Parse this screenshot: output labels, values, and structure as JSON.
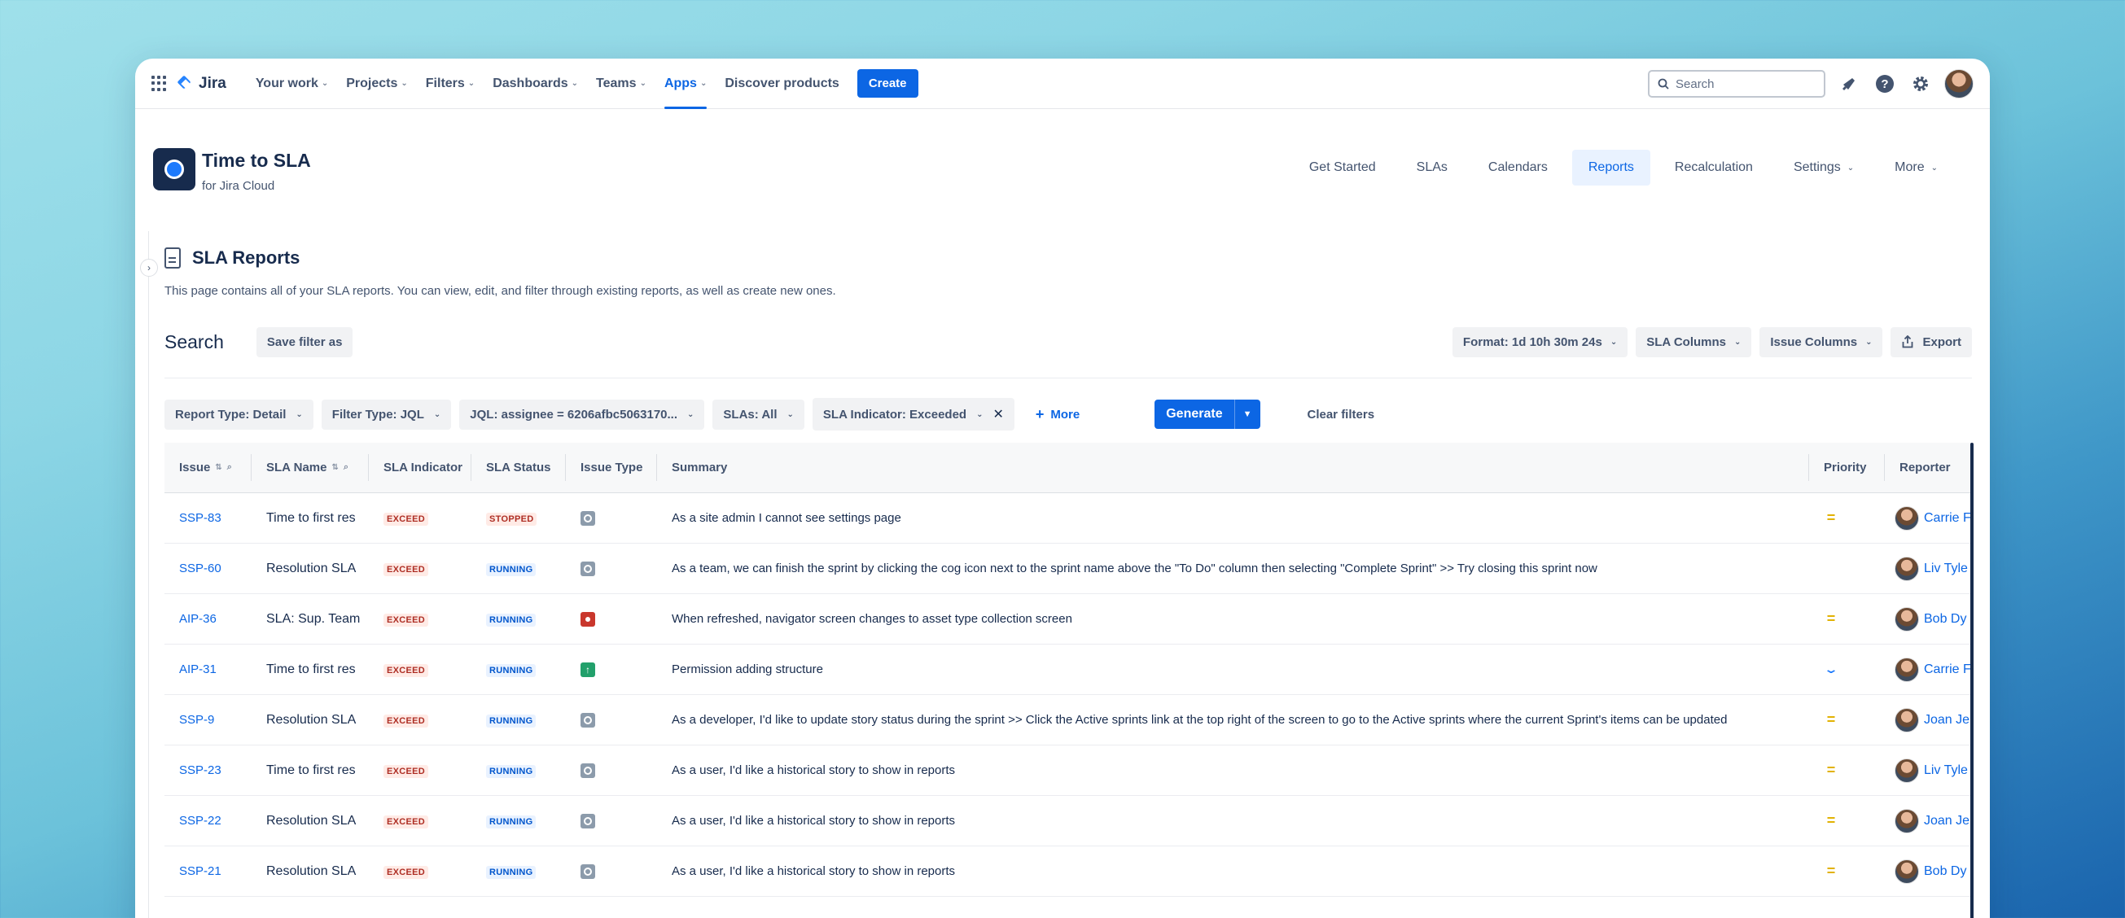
{
  "nav": {
    "logo": "Jira",
    "items": [
      {
        "label": "Your work",
        "chevron": true
      },
      {
        "label": "Projects",
        "chevron": true
      },
      {
        "label": "Filters",
        "chevron": true
      },
      {
        "label": "Dashboards",
        "chevron": true
      },
      {
        "label": "Teams",
        "chevron": true
      },
      {
        "label": "Apps",
        "chevron": true,
        "active": true
      },
      {
        "label": "Discover products",
        "chevron": false
      }
    ],
    "create_label": "Create",
    "search_placeholder": "Search"
  },
  "app": {
    "title": "Time to SLA",
    "subtitle": "for Jira Cloud",
    "tabs": [
      {
        "label": "Get Started"
      },
      {
        "label": "SLAs"
      },
      {
        "label": "Calendars"
      },
      {
        "label": "Reports",
        "active": true
      },
      {
        "label": "Recalculation"
      },
      {
        "label": "Settings",
        "chevron": true
      },
      {
        "label": "More",
        "chevron": true
      }
    ]
  },
  "page": {
    "title": "SLA Reports",
    "description": "This page contains all of your SLA reports. You can view, edit, and filter through existing reports, as well as create new ones."
  },
  "search": {
    "title": "Search",
    "save_filter": "Save filter as",
    "format": "Format: 1d 10h 30m 24s",
    "sla_columns": "SLA Columns",
    "issue_columns": "Issue Columns",
    "export": "Export"
  },
  "filters": {
    "report_type": "Report Type: Detail",
    "filter_type": "Filter Type: JQL",
    "jql": "JQL: assignee = 6206afbc5063170...",
    "slas": "SLAs: All",
    "sla_indicator": "SLA Indicator: Exceeded",
    "more": "More",
    "generate": "Generate",
    "clear": "Clear filters"
  },
  "table": {
    "headers": {
      "issue": "Issue",
      "sla_name": "SLA Name",
      "sla_indicator": "SLA Indicator",
      "sla_status": "SLA Status",
      "issue_type": "Issue Type",
      "summary": "Summary",
      "priority": "Priority",
      "reporter": "Reporter"
    },
    "rows": [
      {
        "issue": "SSP-83",
        "sla": "Time to first res",
        "indicator": "EXCEED",
        "status": "STOPPED",
        "type": "task",
        "summary": "As a site admin I cannot see settings page",
        "priority": "medium",
        "reporter": "Carrie F"
      },
      {
        "issue": "SSP-60",
        "sla": "Resolution SLA",
        "indicator": "EXCEED",
        "status": "RUNNING",
        "type": "task",
        "summary": "As a team, we can finish the sprint by clicking the cog icon next to the sprint name above the \"To Do\" column then selecting \"Complete Sprint\" >> Try closing this sprint now",
        "priority": "none",
        "reporter": "Liv Tyle"
      },
      {
        "issue": "AIP-36",
        "sla": "SLA: Sup. Team",
        "indicator": "EXCEED",
        "status": "RUNNING",
        "type": "bug",
        "summary": "When refreshed, navigator screen changes to asset type collection screen",
        "priority": "medium",
        "reporter": "Bob Dy"
      },
      {
        "issue": "AIP-31",
        "sla": "Time to first res",
        "indicator": "EXCEED",
        "status": "RUNNING",
        "type": "improvement",
        "summary": "Permission adding structure",
        "priority": "low",
        "reporter": "Carrie F"
      },
      {
        "issue": "SSP-9",
        "sla": "Resolution SLA",
        "indicator": "EXCEED",
        "status": "RUNNING",
        "type": "task",
        "summary": "As a developer, I'd like to update story status during the sprint >> Click the Active sprints link at the top right of the screen to go to the Active sprints where the current Sprint's items can be updated",
        "priority": "medium",
        "reporter": "Joan Je"
      },
      {
        "issue": "SSP-23",
        "sla": "Time to first res",
        "indicator": "EXCEED",
        "status": "RUNNING",
        "type": "task",
        "summary": "As a user, I'd like a historical story to show in reports",
        "priority": "medium",
        "reporter": "Liv Tyle"
      },
      {
        "issue": "SSP-22",
        "sla": "Resolution SLA",
        "indicator": "EXCEED",
        "status": "RUNNING",
        "type": "task",
        "summary": "As a user, I'd like a historical story to show in reports",
        "priority": "medium",
        "reporter": "Joan Je"
      },
      {
        "issue": "SSP-21",
        "sla": "Resolution SLA",
        "indicator": "EXCEED",
        "status": "RUNNING",
        "type": "task",
        "summary": "As a user, I'd like a historical story to show in reports",
        "priority": "medium",
        "reporter": "Bob Dy"
      }
    ]
  },
  "colors": {
    "brand": "#0C66E4",
    "exceed_bg": "#FFEBE6",
    "exceed_fg": "#AE2E24",
    "running_bg": "#E9F2FF",
    "running_fg": "#0055CC",
    "priority_medium": "#E2B203",
    "priority_low": "#1D7AFC"
  },
  "icons": {
    "app_switcher": "grid-icon",
    "notifications": "megaphone-icon",
    "help": "help-icon",
    "settings": "gear-icon",
    "search": "search-icon",
    "export": "share-icon"
  }
}
